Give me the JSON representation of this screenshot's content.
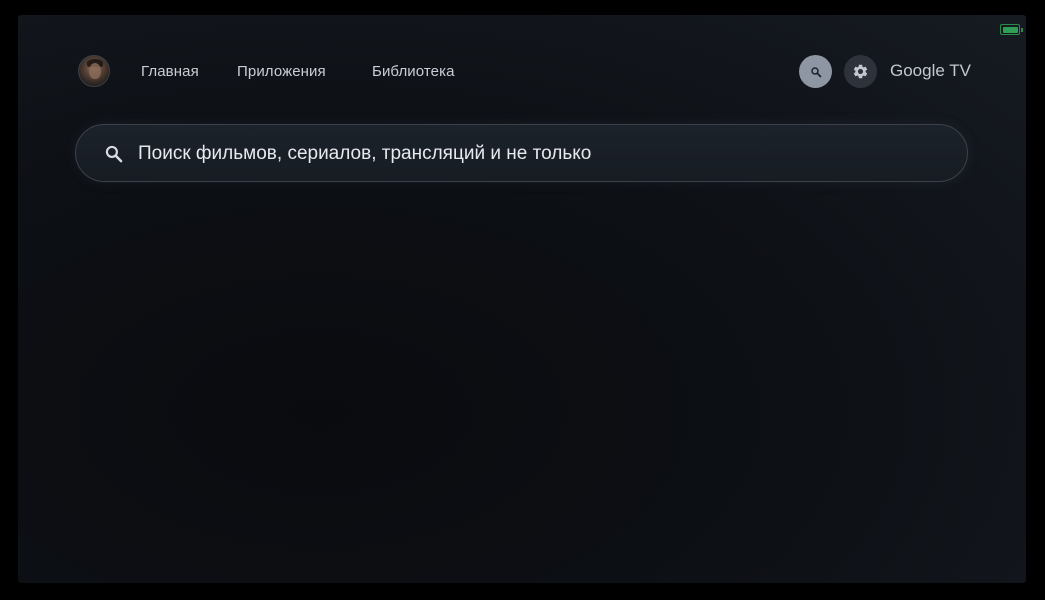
{
  "status": {
    "battery_icon": "battery-icon",
    "battery_color": "#2f9d55"
  },
  "header": {
    "avatar_icon": "profile-avatar",
    "nav": {
      "home": "Главная",
      "apps": "Приложения",
      "library": "Библиотека"
    },
    "search_button_icon": "search-icon",
    "settings_button_icon": "gear-icon",
    "brand": "Google TV"
  },
  "search": {
    "icon": "search-icon",
    "prompt": "Поиск фильмов, сериалов, трансляций и не только"
  },
  "colors": {
    "background": "#0d1015",
    "search_button_bg": "#8f96a3",
    "settings_button_bg": "#2e333b",
    "text": "#c9ced6"
  }
}
